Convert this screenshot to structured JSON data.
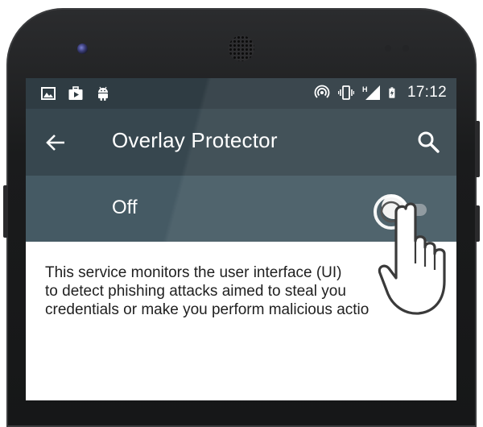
{
  "status_bar": {
    "time": "17:12",
    "icons_left": [
      "image-notification-icon",
      "briefcase-notification-icon",
      "android-notification-icon"
    ],
    "icons_right": [
      "hotspot-icon",
      "vibrate-icon",
      "cell-signal-h-icon",
      "battery-charging-icon"
    ],
    "signal_label": "H"
  },
  "app_bar": {
    "title": "Overlay Protector"
  },
  "switch_bar": {
    "label": "Off",
    "state": "off"
  },
  "description": {
    "text": "This service monitors the user interface (UI)\nto detect phishing attacks aimed to steal you\ncredentials or make you perform malicious actio"
  },
  "colors": {
    "status_bar": "#2f3c43",
    "app_bar": "#37474f",
    "switch_bar": "#455a64"
  }
}
